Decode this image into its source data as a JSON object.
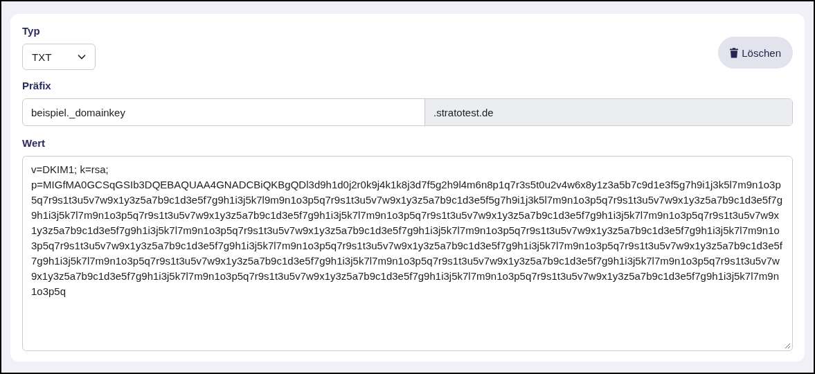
{
  "type_field": {
    "label": "Typ",
    "value": "TXT"
  },
  "delete_button": {
    "label": "Löschen"
  },
  "prefix_field": {
    "label": "Präfix",
    "value": "beispiel._domainkey",
    "suffix": ".stratotest.de"
  },
  "value_field": {
    "label": "Wert",
    "value": "v=DKIM1; k=rsa; p=MIGfMA0GCSqGSIb3DQEBAQUAA4GNADCBiQKBgQDl3d9h1d0j2r0k9j4k1k8j3d7f5g2h9l4m6n8p1q7r3s5t0u2v4w6x8y1z3a5b7c9d1e3f5g7h9i1j3k5l7m9n1o3p5q7r9s1t3u5v7w9x1y3z5a7b9c1d3e5f7g9h1i3j5k7l9m9n1o3p5q7r9s1t3u5v7w9x1y3z5a7b9c1d3e5f5g7h9i1j3k5l7m9n1o3p5q7r9s1t3u5v7w9x1y3z5a7b9c1d3e5f7g9h1i3j5k7l7m9n1o3p5q7r9s1t3u5v7w9x1y3z5a7b9c1d3e5f7g9h1i3j5k7l7m9n1o3p5q7r9s1t3u5v7w9x1y3z5a7b9c1d3e5f7g9h1i3j5k7l7m9n1o3p5q7r9s1t3u5v7w9x1y3z5a7b9c1d3e5f7g9h1i3j5k7l7m9n1o3p5q7r9s1t3u5v7w9x1y3z5a7b9c1d3e5f7g9h1i3j5k7l7m9n1o3p5q7r9s1t3u5v7w9x1y3z5a7b9c1d3e5f7g9h1i3j5k7l7m9n1o3p5q7r9s1t3u5v7w9x1y3z5a7b9c1d3e5f7g9h1i3j5k7l7m9n1o3p5q7r9s1t3u5v7w9x1y3z5a7b9c1d3e5f7g9h1i3j5k7l7m9n1o3p5q7r9s1t3u5v7w9x1y3z5a7b9c1d3e5f7g9h1i3j5k7l7m9n1o3p5q7r9s1t3u5v7w9x1y3z5a7b9c1d3e5f7g9h1i3j5k7l7m9n1o3p5q7r9s1t3u5v7w9x1y3z5a7b9c1d3e5f7g9h1i3j5k7l7m9n1o3p5q7r9s1t3u5v7w9x1y3z5a7b9c1d3e5f7g9h1i3j5k7l7m9n1o3p5q7r9s1t3u5v7w9x1y3z5a7b9c1d3e5f7g9h1i3j5k7l7m9n1o3p5q7r9s1t3u5v7w9x1y3z5a7b9c1d3e5f7g9h1i3j5k7l7m9n1o3p5q"
  }
}
